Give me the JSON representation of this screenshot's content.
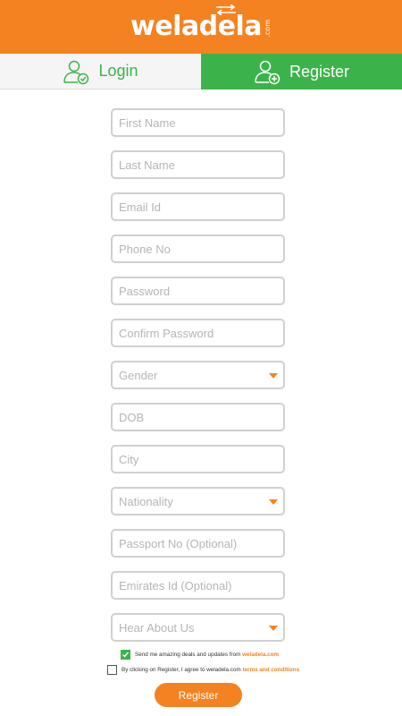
{
  "brand": {
    "logo_text": "weladela",
    "logo_suffix": ".com",
    "primary_color": "#f58220",
    "accent_color": "#3cb34a"
  },
  "tabs": [
    {
      "label": "Login",
      "icon": "user-check-icon",
      "active": false
    },
    {
      "label": "Register",
      "icon": "user-add-icon",
      "active": true
    }
  ],
  "form": {
    "first_name": {
      "placeholder": "First Name",
      "value": ""
    },
    "last_name": {
      "placeholder": "Last Name",
      "value": ""
    },
    "email": {
      "placeholder": "Email Id",
      "value": ""
    },
    "phone": {
      "placeholder": "Phone No",
      "value": ""
    },
    "password": {
      "placeholder": "Password",
      "value": ""
    },
    "confirm_password": {
      "placeholder": "Confirm Password",
      "value": ""
    },
    "gender": {
      "selected": "Gender"
    },
    "dob": {
      "placeholder": "DOB",
      "value": ""
    },
    "city": {
      "placeholder": "City",
      "value": ""
    },
    "nationality": {
      "selected": "Nationality"
    },
    "passport": {
      "placeholder": "Passport No (Optional)",
      "value": ""
    },
    "emirates_id": {
      "placeholder": "Emirates Id (Optional)",
      "value": ""
    },
    "hear_about": {
      "selected": "Hear About Us"
    }
  },
  "newsletter": {
    "checked": true,
    "text": "Send me amazing deals and updates from ",
    "link": "weladela.com"
  },
  "terms": {
    "checked": false,
    "text": "By clicking on Register, I agree to weladela.com ",
    "link": "terms and conditions"
  },
  "register_button": {
    "label": "Register"
  }
}
